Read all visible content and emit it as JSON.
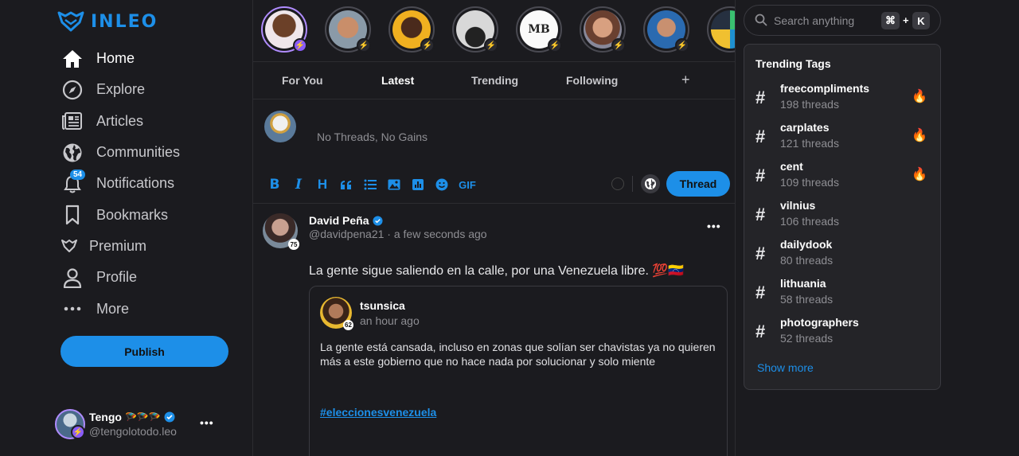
{
  "brand": {
    "name": "INLEO",
    "accent": "#1d8fe8"
  },
  "sidebar": {
    "items": [
      {
        "label": "Home",
        "icon": "home-icon",
        "active": true
      },
      {
        "label": "Explore",
        "icon": "compass-icon"
      },
      {
        "label": "Articles",
        "icon": "newspaper-icon"
      },
      {
        "label": "Communities",
        "icon": "globe-icon"
      },
      {
        "label": "Notifications",
        "icon": "bell-icon",
        "badge": "54"
      },
      {
        "label": "Bookmarks",
        "icon": "bookmark-icon"
      },
      {
        "label": "Premium",
        "icon": "leo-logo-icon"
      },
      {
        "label": "Profile",
        "icon": "user-icon"
      },
      {
        "label": "More",
        "icon": "more-dots-icon"
      }
    ],
    "publish_label": "Publish",
    "account": {
      "name": "Tengo",
      "emoji": "🪂🪂🪂",
      "handle": "@tengolotodo.leo"
    }
  },
  "feed": {
    "tabs": [
      "For You",
      "Latest",
      "Trending",
      "Following"
    ],
    "active_tab": "Latest",
    "add_tab": "+",
    "composer": {
      "placeholder": "No Threads, No Gains",
      "gif_label": "GIF",
      "submit_label": "Thread"
    },
    "post": {
      "author": "David Peña",
      "handle": "@davidpena21 · a few seconds ago",
      "reputation": "75",
      "text": "La gente sigue saliendo en la calle, por una Venezuela libre. 💯🇻🇪",
      "quote": {
        "author": "tsunsica",
        "time": "an hour ago",
        "reputation": "62",
        "text": "La gente está cansada, incluso en zonas que solían ser chavistas ya no quieren más a este gobierno que no hace nada por solucionar y solo miente",
        "tag": "#eleccionesvenezuela"
      }
    }
  },
  "search": {
    "placeholder": "Search anything",
    "shortcut_mod": "⌘",
    "shortcut_plus": "+",
    "shortcut_key": "K"
  },
  "trending": {
    "title": "Trending Tags",
    "tags": [
      {
        "name": "freecompliments",
        "count": "198 threads",
        "hot": true
      },
      {
        "name": "carplates",
        "count": "121 threads",
        "hot": true
      },
      {
        "name": "cent",
        "count": "109 threads",
        "hot": true
      },
      {
        "name": "vilnius",
        "count": "106 threads",
        "hot": false
      },
      {
        "name": "dailydook",
        "count": "80 threads",
        "hot": false
      },
      {
        "name": "lithuania",
        "count": "58 threads",
        "hot": false
      },
      {
        "name": "photographers",
        "count": "52 threads",
        "hot": false
      }
    ],
    "show_more": "Show more"
  }
}
